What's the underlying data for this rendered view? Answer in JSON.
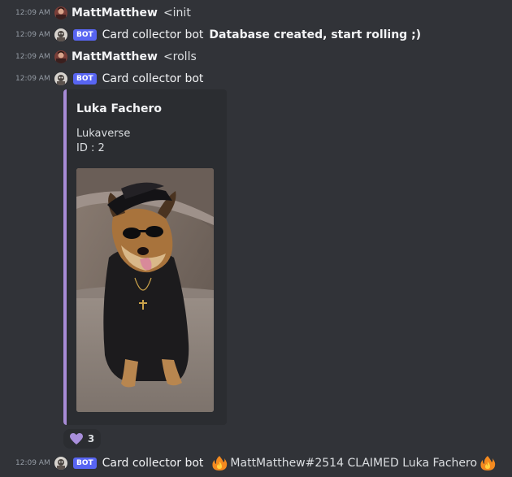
{
  "messages": [
    {
      "timestamp": "12:09 AM",
      "username": "MattMatthew",
      "text": "<init"
    },
    {
      "timestamp": "12:09 AM",
      "bot_badge": "BOT",
      "username": "Card collector bot",
      "text": "Database created, start rolling ;)"
    },
    {
      "timestamp": "12:09 AM",
      "username": "MattMatthew",
      "text": "<rolls"
    },
    {
      "timestamp": "12:09 AM",
      "bot_badge": "BOT",
      "username": "Card collector bot"
    },
    {
      "timestamp": "12:09 AM",
      "bot_badge": "BOT",
      "username": "Card collector bot",
      "text": "MattMatthew#2514 CLAIMED Luka Fachero"
    }
  ],
  "embed": {
    "title": "Luka Fachero",
    "series": "Lukaverse",
    "id_line": "ID : 2",
    "accent_color": "#a78bd6"
  },
  "reaction": {
    "icon": "purple-heart-icon",
    "count": "3"
  },
  "colors": {
    "background": "#313338",
    "embed_bg": "#2b2d31",
    "bot_badge": "#5865f2"
  }
}
